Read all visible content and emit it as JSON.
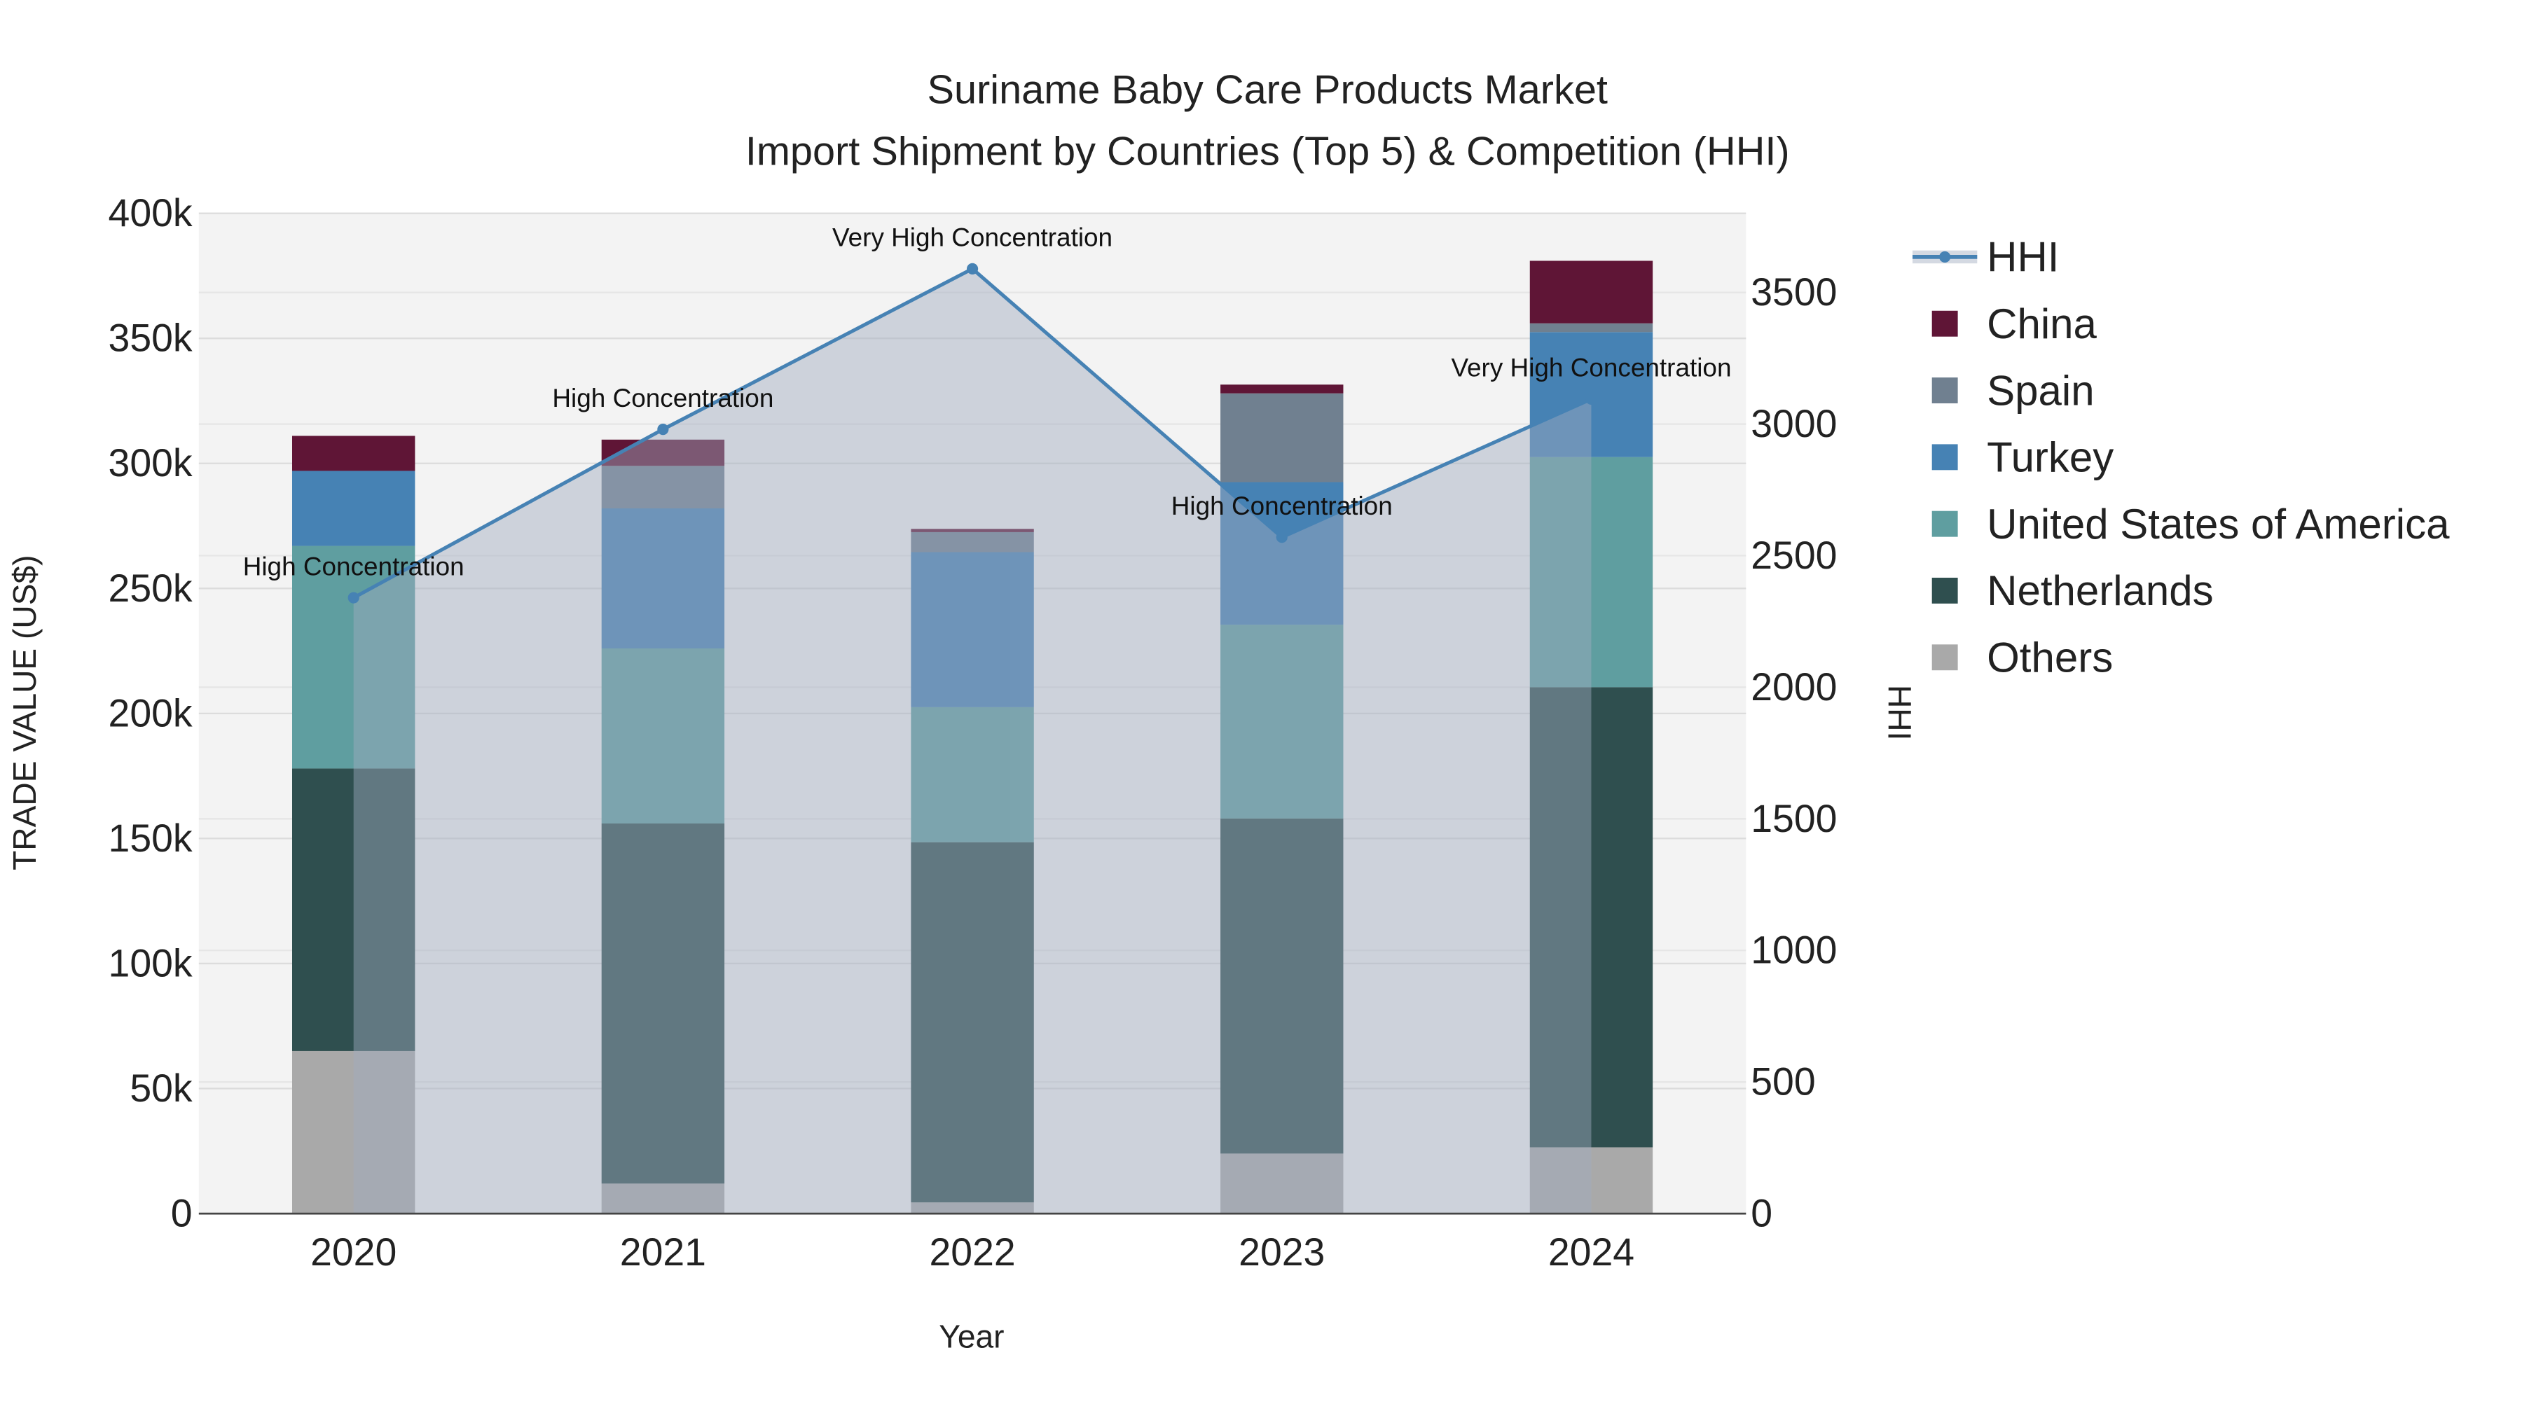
{
  "chart_data": {
    "type": "bar",
    "stacked": true,
    "title": [
      "Suriname Baby Care Products Market",
      "Import Shipment by Countries (Top 5) & Competition (HHI)"
    ],
    "xlabel": "Year",
    "ylabel": "TRADE VALUE (US$)",
    "y2label": "HHI",
    "categories": [
      "2020",
      "2021",
      "2022",
      "2023",
      "2024"
    ],
    "ylim": [
      0,
      400000
    ],
    "yticks": [
      0,
      50000,
      100000,
      150000,
      200000,
      250000,
      300000,
      350000,
      400000
    ],
    "ytick_labels": [
      "0",
      "50k",
      "100k",
      "150k",
      "200k",
      "250k",
      "300k",
      "350k",
      "400k"
    ],
    "y2lim": [
      0,
      3800
    ],
    "y2ticks": [
      0,
      500,
      1000,
      1500,
      2000,
      2500,
      3000,
      3500
    ],
    "y2tick_labels": [
      "0",
      "500",
      "1000",
      "1500",
      "2000",
      "2500",
      "3000",
      "3500"
    ],
    "series": [
      {
        "name": "Others",
        "color": "#a9a9a9",
        "values": [
          65000,
          12000,
          4500,
          24000,
          26500
        ]
      },
      {
        "name": "Netherlands",
        "color": "#2f4f4f",
        "values": [
          113000,
          144000,
          144000,
          134000,
          184000
        ]
      },
      {
        "name": "United States of America",
        "color": "#5f9ea0",
        "values": [
          89000,
          70000,
          54000,
          77500,
          92000
        ]
      },
      {
        "name": "Turkey",
        "color": "#4682b4",
        "values": [
          30000,
          56000,
          62000,
          57000,
          50000
        ]
      },
      {
        "name": "Spain",
        "color": "#708090",
        "values": [
          0,
          17000,
          8000,
          35500,
          3500
        ]
      },
      {
        "name": "China",
        "color": "#5f1536",
        "values": [
          14000,
          10500,
          1300,
          3500,
          25000
        ]
      }
    ],
    "hhi": {
      "name": "HHI",
      "color": "#4682b4",
      "values": [
        2340,
        2980,
        3590,
        2570,
        3095
      ],
      "annotations": [
        "High Concentration",
        "High Concentration",
        "Very High Concentration",
        "High Concentration",
        "Very High Concentration"
      ]
    },
    "legend_order": [
      "HHI",
      "China",
      "Spain",
      "Turkey",
      "United States of America",
      "Netherlands",
      "Others"
    ],
    "legend_position": "right",
    "grid": true
  }
}
